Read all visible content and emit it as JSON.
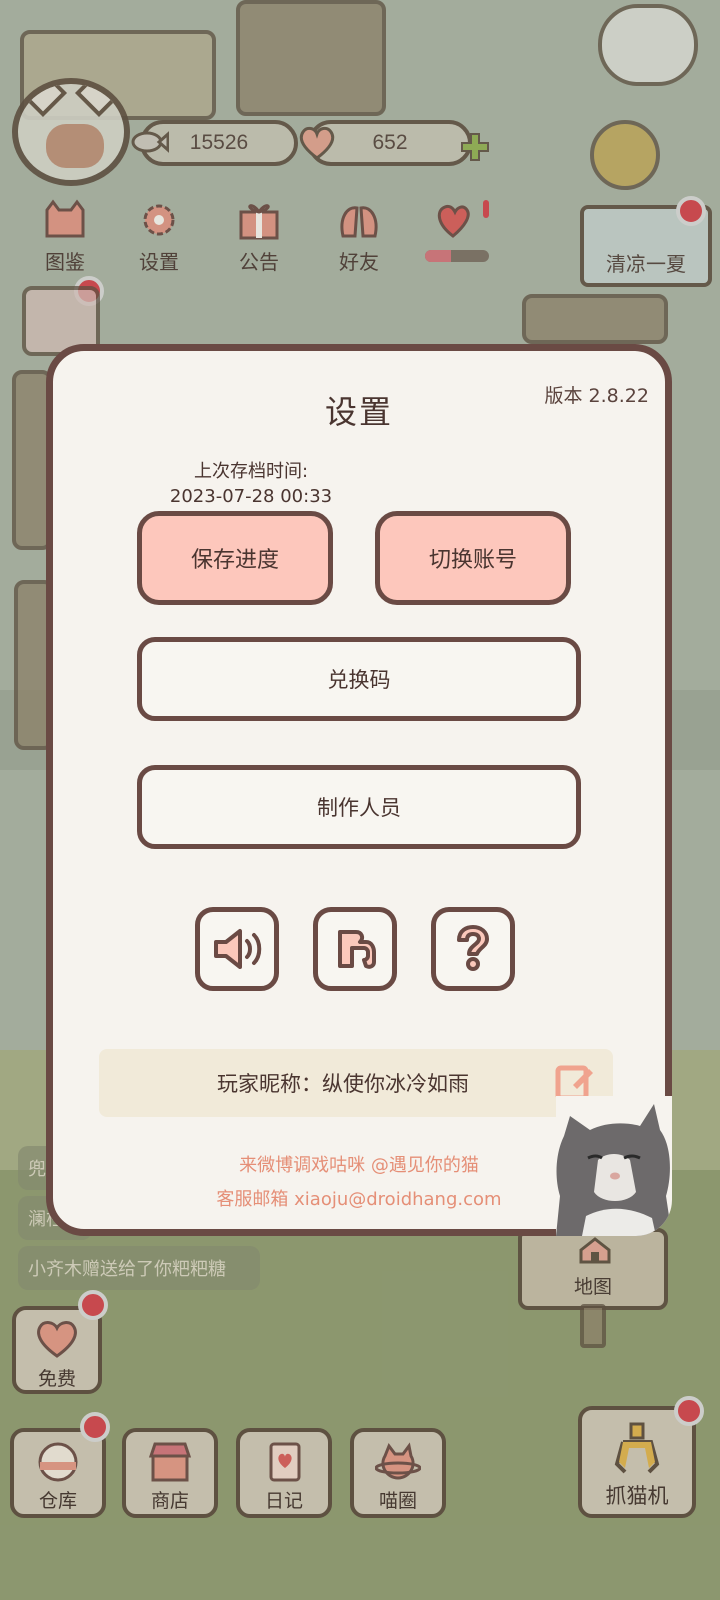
{
  "hud": {
    "coins": "15526",
    "hearts": "652"
  },
  "menu": {
    "items": [
      {
        "label": "图鉴"
      },
      {
        "label": "设置"
      },
      {
        "label": "公告"
      },
      {
        "label": "好友"
      }
    ],
    "event_sign": "清凉一夏"
  },
  "chat": {
    "line1": "兜",
    "line2": "澜柱",
    "line3": "小齐木赠送给了你粑粑糖"
  },
  "map_sign": "地图",
  "bottom_bar": {
    "free": "免费",
    "items": [
      {
        "label": "仓库"
      },
      {
        "label": "商店"
      },
      {
        "label": "日记"
      },
      {
        "label": "喵圈"
      }
    ],
    "claw": "抓猫机"
  },
  "dialog": {
    "title": "设置",
    "version": "版本 2.8.22",
    "last_save_label": "上次存档时间:",
    "last_save_time": "2023-07-28 00:33",
    "save_button": "保存进度",
    "switch_account_button": "切换账号",
    "redeem_button": "兑换码",
    "credits_button": "制作人员",
    "nickname_label": "玩家昵称：",
    "nickname_value": "纵使你冰冷如雨",
    "weibo_line": "来微博调戏咕咪 @遇见你的猫",
    "email_line": "客服邮箱 xiaoju@droidhang.com"
  },
  "colors": {
    "dialog_border": "#6a4a44",
    "primary_button": "#fdc7bc",
    "accent_text": "#e58f77",
    "badge": "#d2414a"
  }
}
